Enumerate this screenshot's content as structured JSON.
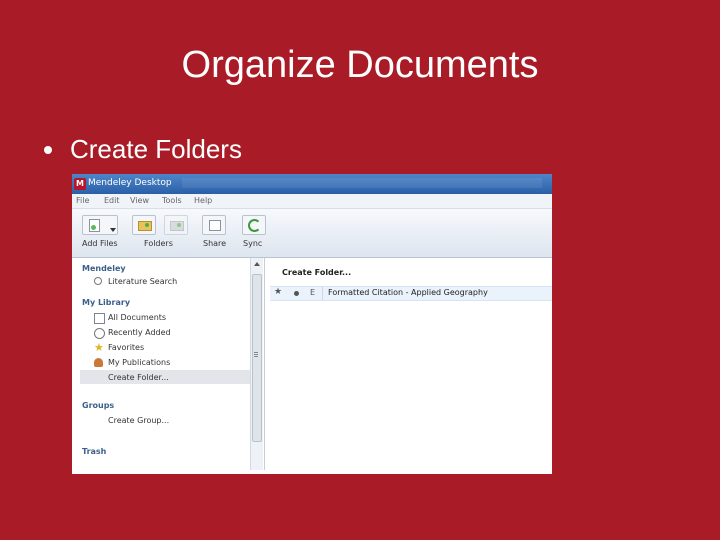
{
  "slide": {
    "title": "Organize Documents",
    "bullet": "Create Folders"
  },
  "app": {
    "window_title": "Mendeley Desktop",
    "logo_letter": "M",
    "menu": [
      "File",
      "Edit",
      "View",
      "Tools",
      "Help"
    ],
    "toolbar": {
      "add_files": "Add Files",
      "folders": "Folders",
      "share": "Share",
      "sync": "Sync"
    },
    "sidebar": {
      "mendeley_header": "Mendeley",
      "literature_search": "Literature Search",
      "my_library_header": "My Library",
      "all_documents": "All Documents",
      "recently_added": "Recently Added",
      "favorites": "Favorites",
      "my_publications": "My Publications",
      "create_folder": "Create Folder...",
      "groups_header": "Groups",
      "create_group": "Create Group...",
      "trash_header": "Trash"
    },
    "content": {
      "heading": "Create Folder...",
      "row": {
        "star": "★",
        "type": "E",
        "title": "Formatted Citation - Applied Geography"
      }
    }
  }
}
